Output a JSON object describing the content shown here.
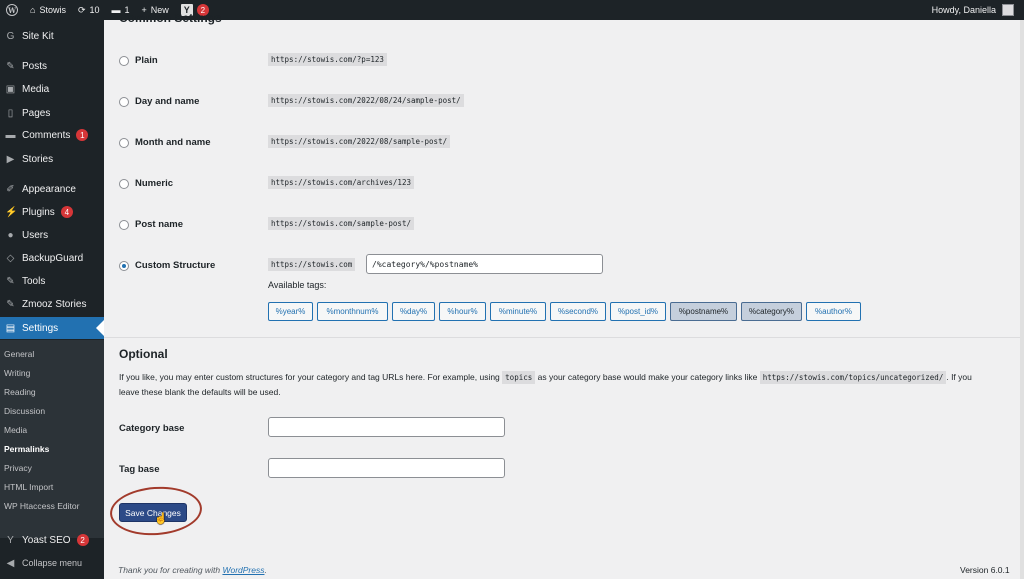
{
  "adminbar": {
    "site_name": "Stowis",
    "updates_count": "10",
    "comments_count": "1",
    "new_label": "New",
    "yoast_badge": "2",
    "howdy": "Howdy, Daniella"
  },
  "sidebar": {
    "items": [
      {
        "label": "Site Kit",
        "icon": "g-icon"
      },
      {
        "label": "Posts",
        "icon": "pin-icon"
      },
      {
        "label": "Media",
        "icon": "media-icon"
      },
      {
        "label": "Pages",
        "icon": "page-icon"
      },
      {
        "label": "Comments",
        "icon": "comment-icon",
        "badge": "1"
      },
      {
        "label": "Stories",
        "icon": "play-icon"
      },
      {
        "label": "Appearance",
        "icon": "brush-icon"
      },
      {
        "label": "Plugins",
        "icon": "plug-icon",
        "badge": "4"
      },
      {
        "label": "Users",
        "icon": "user-icon"
      },
      {
        "label": "BackupGuard",
        "icon": "shield-icon"
      },
      {
        "label": "Tools",
        "icon": "wrench-icon"
      },
      {
        "label": "Zmooz Stories",
        "icon": "pin-icon"
      },
      {
        "label": "Settings",
        "icon": "settings-icon"
      }
    ],
    "submenu": [
      "General",
      "Writing",
      "Reading",
      "Discussion",
      "Media",
      "Permalinks",
      "Privacy",
      "HTML Import",
      "WP Htaccess Editor"
    ],
    "yoast": {
      "label": "Yoast SEO",
      "badge": "2"
    },
    "collapse": "Collapse menu"
  },
  "common": {
    "title": "Common Settings",
    "options": [
      {
        "label": "Plain",
        "example": "https://stowis.com/?p=123"
      },
      {
        "label": "Day and name",
        "example": "https://stowis.com/2022/08/24/sample-post/"
      },
      {
        "label": "Month and name",
        "example": "https://stowis.com/2022/08/sample-post/"
      },
      {
        "label": "Numeric",
        "example": "https://stowis.com/archives/123"
      },
      {
        "label": "Post name",
        "example": "https://stowis.com/sample-post/"
      },
      {
        "label": "Custom Structure",
        "example": "https://stowis.com"
      }
    ],
    "custom_value": "/%category%/%postname%",
    "available_tags_label": "Available tags:",
    "tags": [
      "%year%",
      "%monthnum%",
      "%day%",
      "%hour%",
      "%minute%",
      "%second%",
      "%post_id%",
      "%postname%",
      "%category%",
      "%author%"
    ]
  },
  "optional": {
    "title": "Optional",
    "para_1": "If you like, you may enter custom structures for your category and tag URLs here. For example, using",
    "code_topics": "topics",
    "para_2": "as your category base would make your category links like",
    "code_url": "https://stowis.com/topics/uncategorized/",
    "para_3": ". If you",
    "para_line2": "leave these blank the defaults will be used.",
    "category_base_label": "Category base",
    "tag_base_label": "Tag base"
  },
  "save_button": "Save Changes",
  "footer": {
    "thanks_prefix": "Thank you for creating with",
    "thanks_link": "WordPress",
    "thanks_suffix": ".",
    "version": "Version 6.0.1"
  }
}
